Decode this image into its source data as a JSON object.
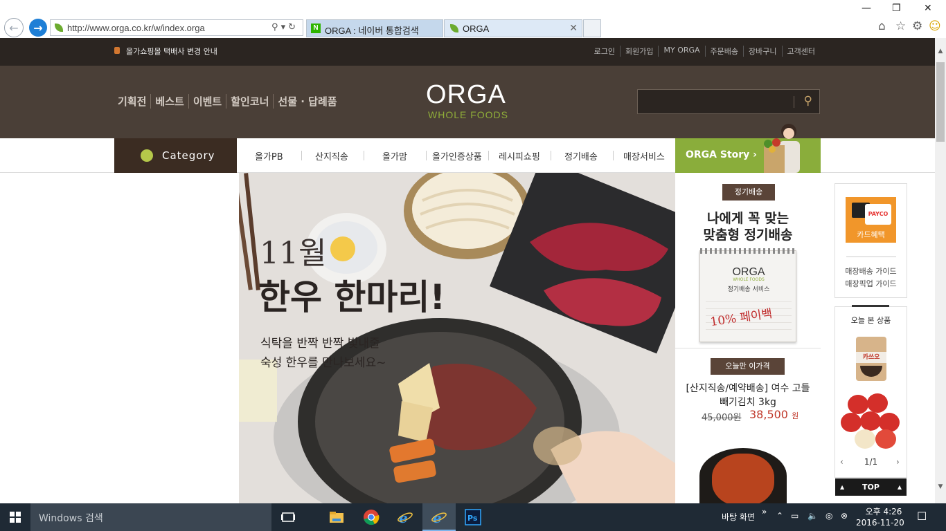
{
  "browser": {
    "url": "http://www.orga.co.kr/w/index.orga",
    "tabs": [
      {
        "label": "ORGA : 네이버 통합검색"
      },
      {
        "label": "ORGA"
      }
    ]
  },
  "topbar": {
    "notice": "올가쇼핑몰 택배사 변경 안내",
    "links": [
      "로그인",
      "회원가입",
      "MY ORGA",
      "주문배송",
      "장바구니",
      "고객센터"
    ]
  },
  "header": {
    "nav": [
      "기획전",
      "베스트",
      "이벤트",
      "할인코너",
      "선물 · 답례품"
    ],
    "logo": "ORGA",
    "logo_sub": "WHOLE FOODS"
  },
  "catnav": {
    "category": "Category",
    "items": [
      "올가PB",
      "산지직송",
      "올가맘",
      "올가인증상품",
      "레시피쇼핑",
      "정기배송",
      "매장서비스"
    ],
    "story": "ORGA Story ›"
  },
  "banner": {
    "month": "11월",
    "title": "한우 한마리!",
    "sub1": "식탁을 반짝 반짝 빛내줄",
    "sub2": "숙성 한우를 만나보세요~"
  },
  "regular": {
    "chip": "정기배송",
    "title1": "나에게 꼭 맞는",
    "title2": "맞춤형 정기배송",
    "card_logo": "ORGA",
    "card_sub": "WHOLE FOODS",
    "card_service": "정기배송 서비스",
    "card_payback": "10% 페이백"
  },
  "deal": {
    "chip": "오늘만 이가격",
    "name1": "[산지직송/예약배송] 여수 고들",
    "name2": "빼기김치 3kg",
    "old_price": "45,000원",
    "new_price": "38,500",
    "unit": "원"
  },
  "side": {
    "payco": "PAYCO",
    "card_benefit": "카드혜택",
    "links": [
      "매장배송 가이드",
      "매장픽업 가이드"
    ],
    "seen_title": "오늘 본 상품",
    "product1_label": "카쓰오",
    "pager": "1/1",
    "top": "TOP"
  },
  "taskbar": {
    "search": "Windows 검색",
    "desktop": "바탕 화면",
    "time": "오후 4:26",
    "date": "2016-11-20"
  }
}
